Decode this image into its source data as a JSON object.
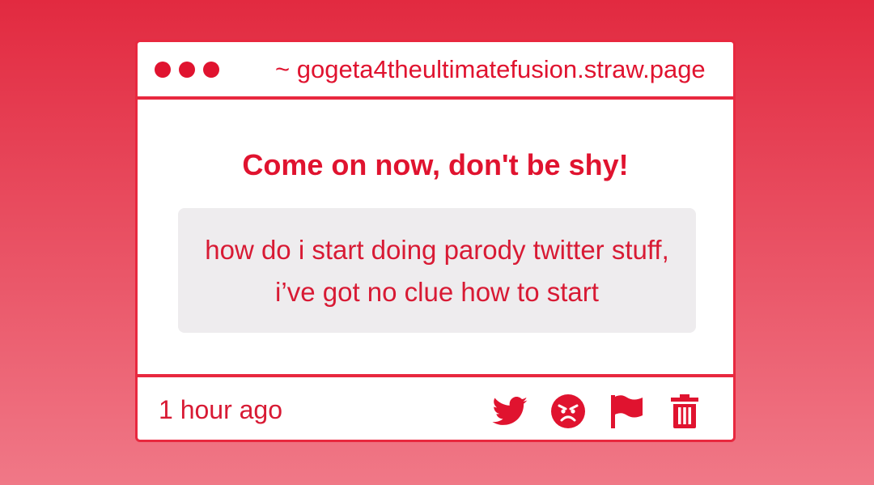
{
  "header": {
    "url": "~ gogeta4theultimatefusion.straw.page"
  },
  "main": {
    "title": "Come on now, don't be shy!",
    "message": "how do i start doing parody twitter stuff, i’ve got no clue how to start"
  },
  "footer": {
    "timestamp": "1 hour ago",
    "actions": [
      {
        "icon": "twitter-bird-icon"
      },
      {
        "icon": "angry-face-icon"
      },
      {
        "icon": "flag-icon"
      },
      {
        "icon": "trash-icon"
      }
    ]
  },
  "colors": {
    "accent": "#e0132f",
    "background_top": "#e22a40",
    "background_bottom": "#f07887",
    "message_bg": "#eeecee"
  }
}
